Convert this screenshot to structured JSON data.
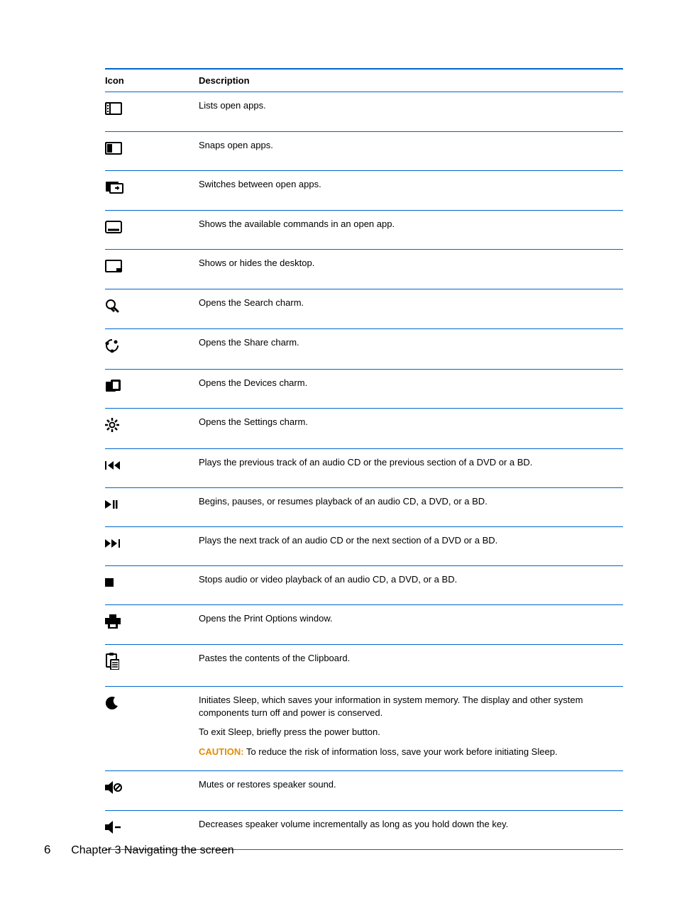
{
  "headers": {
    "icon": "Icon",
    "description": "Description"
  },
  "rows": [
    {
      "icon": "list-apps-icon",
      "desc": [
        "Lists open apps."
      ]
    },
    {
      "icon": "snap-apps-icon",
      "desc": [
        "Snaps open apps."
      ]
    },
    {
      "icon": "switch-apps-icon",
      "desc": [
        "Switches between open apps."
      ]
    },
    {
      "icon": "app-commands-icon",
      "desc": [
        "Shows the available commands in an open app."
      ]
    },
    {
      "icon": "show-desktop-icon",
      "desc": [
        "Shows or hides the desktop."
      ]
    },
    {
      "icon": "search-icon",
      "desc": [
        "Opens the Search charm."
      ]
    },
    {
      "icon": "share-icon",
      "desc": [
        "Opens the Share charm."
      ]
    },
    {
      "icon": "devices-icon",
      "desc": [
        "Opens the Devices charm."
      ]
    },
    {
      "icon": "settings-icon",
      "desc": [
        "Opens the Settings charm."
      ]
    },
    {
      "icon": "previous-track-icon",
      "desc": [
        "Plays the previous track of an audio CD or the previous section of a DVD or a BD."
      ]
    },
    {
      "icon": "play-pause-icon",
      "desc": [
        "Begins, pauses, or resumes playback of an audio CD, a DVD, or a BD."
      ]
    },
    {
      "icon": "next-track-icon",
      "desc": [
        "Plays the next track of an audio CD or the next section of a DVD or a BD."
      ]
    },
    {
      "icon": "stop-icon",
      "desc": [
        "Stops audio or video playback of an audio CD, a DVD, or a BD."
      ]
    },
    {
      "icon": "print-icon",
      "desc": [
        "Opens the Print Options window."
      ]
    },
    {
      "icon": "paste-icon",
      "desc": [
        "Pastes the contents of the Clipboard."
      ]
    },
    {
      "icon": "sleep-icon",
      "desc": [
        "Initiates Sleep, which saves your information in system memory. The display and other system components turn off and power is conserved.",
        "To exit Sleep, briefly press the power button.",
        {
          "caution": "CAUTION:",
          "text": "To reduce the risk of information loss, save your work before initiating Sleep."
        }
      ]
    },
    {
      "icon": "mute-icon",
      "desc": [
        "Mutes or restores speaker sound."
      ]
    },
    {
      "icon": "volume-down-icon",
      "desc": [
        "Decreases speaker volume incrementally as long as you hold down the key."
      ]
    }
  ],
  "footer": {
    "page": "6",
    "chapter": "Chapter 3   Navigating the screen"
  }
}
